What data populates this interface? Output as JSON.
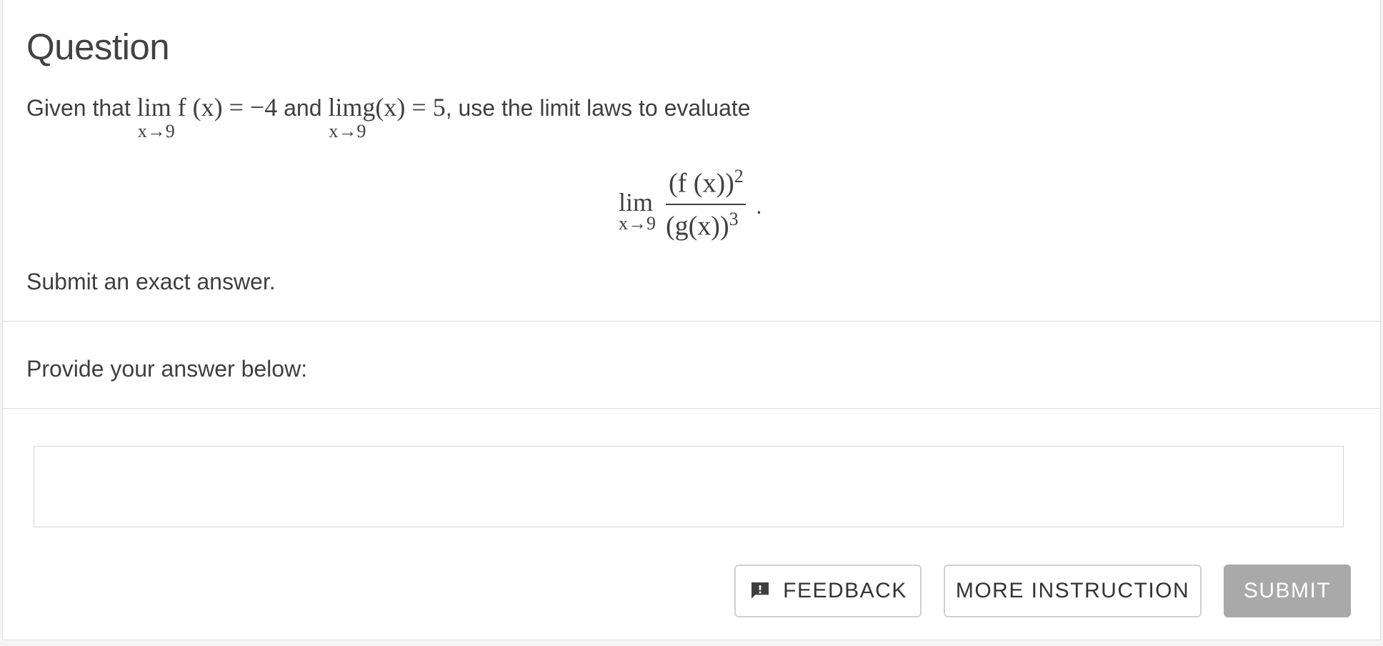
{
  "question": {
    "title": "Question",
    "prompt": {
      "given_that": "Given that",
      "lim1": "lim",
      "lim1_sub": "x→9",
      "expr1": "f (x) = −4",
      "and": "and",
      "lim2": "lim",
      "lim2_sub": "x→9",
      "expr2": "g(x) = 5",
      "suffix": ", use the limit laws to evaluate"
    },
    "display_math": {
      "lim": "lim",
      "lim_sub": "x→9",
      "numerator": "(f (x))",
      "numerator_exp": "2",
      "denominator": "(g(x))",
      "denominator_exp": "3",
      "trailing": "."
    },
    "instruction": "Submit an exact answer."
  },
  "answer": {
    "label": "Provide your answer below:",
    "value": "",
    "placeholder": ""
  },
  "actions": {
    "feedback_label": "FEEDBACK",
    "feedback_icon": "feedback-alert-icon",
    "more_instruction_label": "MORE INSTRUCTION",
    "submit_label": "SUBMIT"
  },
  "colors": {
    "text": "#3f3f3f",
    "divider": "#dcdcdc",
    "submit_disabled_bg": "#a9a9a9"
  }
}
